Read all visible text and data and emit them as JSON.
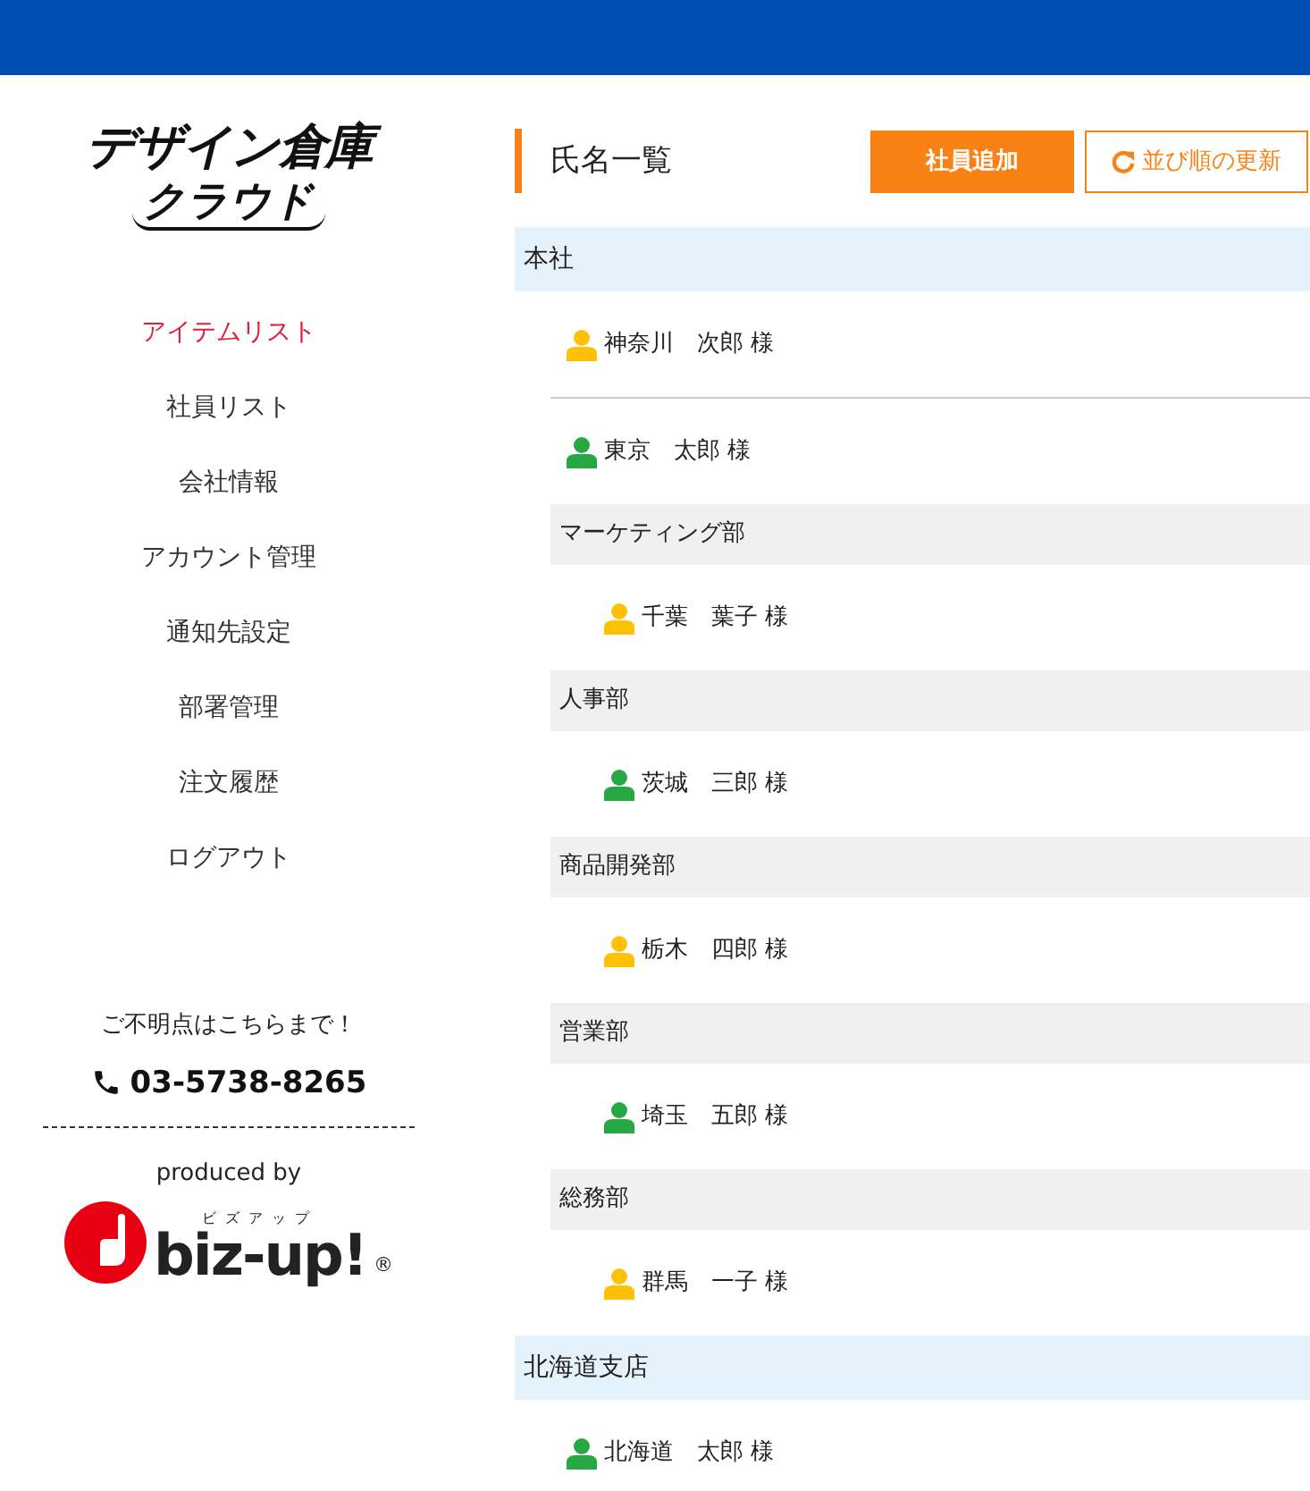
{
  "logo": {
    "line1": "デザイン倉庫",
    "line2": "クラウド"
  },
  "nav": [
    {
      "label": "アイテムリスト",
      "selected": true
    },
    {
      "label": "社員リスト",
      "selected": false
    },
    {
      "label": "会社情報",
      "selected": false
    },
    {
      "label": "アカウント管理",
      "selected": false
    },
    {
      "label": "通知先設定",
      "selected": false
    },
    {
      "label": "部署管理",
      "selected": false
    },
    {
      "label": "注文履歴",
      "selected": false
    },
    {
      "label": "ログアウト",
      "selected": false
    }
  ],
  "contact": {
    "note": "ご不明点はこちらまで！",
    "phone": "03-5738-8265"
  },
  "producer": {
    "caption": "produced by",
    "name": "biz-up!",
    "kana": "ビズアップ",
    "mark": "®"
  },
  "main": {
    "title": "氏名一覧",
    "buttons": [
      {
        "kind": "primary",
        "label": "社員追加"
      },
      {
        "kind": "refresh",
        "label": "並び順の更新"
      }
    ]
  },
  "offices": [
    {
      "name": "本社",
      "members": [
        {
          "name": "神奈川　次郎 様",
          "color": "#ffc107"
        },
        {
          "name": "東京　太郎 様",
          "color": "#28a745"
        }
      ],
      "departments": [
        {
          "name": "マーケティング部",
          "members": [
            {
              "name": "千葉　葉子 様",
              "color": "#ffc107"
            }
          ]
        },
        {
          "name": "人事部",
          "members": [
            {
              "name": "茨城　三郎 様",
              "color": "#28a745"
            }
          ]
        },
        {
          "name": "商品開発部",
          "members": [
            {
              "name": "栃木　四郎 様",
              "color": "#ffc107"
            }
          ]
        },
        {
          "name": "営業部",
          "members": [
            {
              "name": "埼玉　五郎 様",
              "color": "#28a745"
            }
          ]
        },
        {
          "name": "総務部",
          "members": [
            {
              "name": "群馬　一子 様",
              "color": "#ffc107"
            }
          ]
        }
      ]
    },
    {
      "name": "北海道支店",
      "members": [
        {
          "name": "北海道　太郎 様",
          "color": "#28a745"
        }
      ]
    }
  ]
}
